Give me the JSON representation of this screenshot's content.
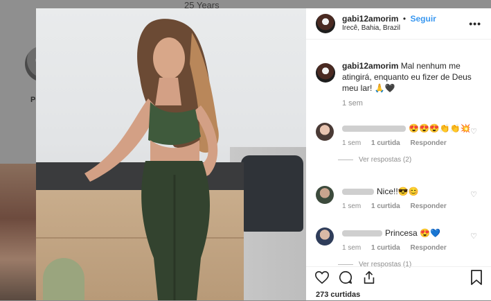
{
  "background": {
    "top_text": "25 Years",
    "profile_name_fragment": "Pe"
  },
  "post": {
    "username": "gabi12amorim",
    "separator": "•",
    "follow_label": "Seguir",
    "location": "Irecê, Bahia, Brazil",
    "more_label": "•••",
    "caption_user": "gabi12amorim",
    "caption_text": "Mal nenhum me atingirá, enquanto eu fizer de Deus meu lar! 🙏🖤",
    "caption_time": "1 sem",
    "likes": "273 curtidas"
  },
  "comments": [
    {
      "text": "😍😍😍👏👏💥",
      "time": "1 sem",
      "likes": "1 curtida",
      "reply": "Responder",
      "view_replies": "Ver respostas (2)"
    },
    {
      "text": "Nice!!😎😊",
      "time": "1 sem",
      "likes": "1 curtida",
      "reply": "Responder",
      "view_replies": ""
    },
    {
      "text": "Princesa 😍💙",
      "time": "1 sem",
      "likes": "1 curtida",
      "reply": "Responder",
      "view_replies": "Ver respostas (1)"
    }
  ],
  "icons": {
    "like": "heart-icon",
    "comment": "comment-icon",
    "share": "share-icon",
    "save": "bookmark-icon"
  }
}
